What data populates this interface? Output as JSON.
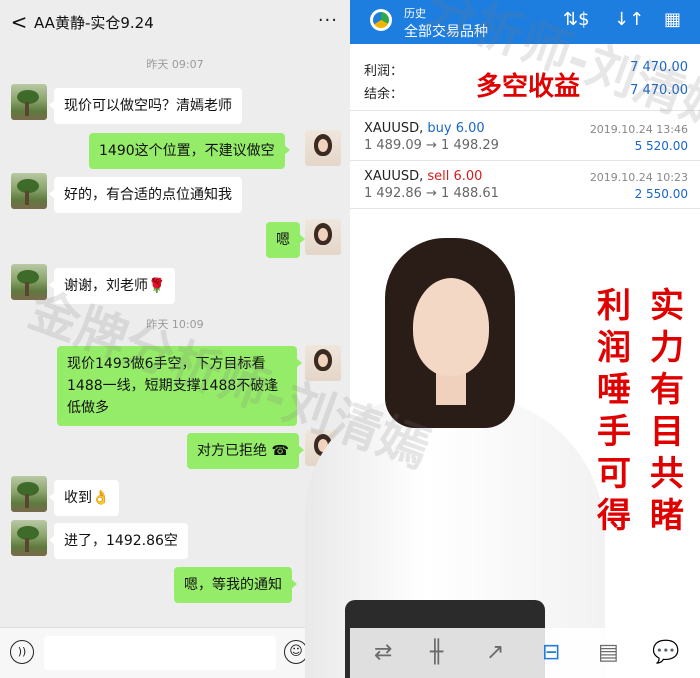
{
  "chat": {
    "title": "AA黄静-实仓9.24",
    "back_glyph": "<",
    "more_glyph": "···",
    "timestamps": [
      "昨天 09:07",
      "昨天 10:09"
    ],
    "messages": [
      {
        "side": "left",
        "text": "现价可以做空吗？清嫣老师"
      },
      {
        "side": "right",
        "text": "1490这个位置，不建议做空"
      },
      {
        "side": "left",
        "text": "好的，有合适的点位通知我"
      },
      {
        "side": "right",
        "text": "嗯"
      },
      {
        "side": "left",
        "text": "谢谢，刘老师🌹"
      },
      {
        "side": "right",
        "text": "现价1493做6手空，下方目标看1488一线，短期支撑1488不破逢低做多"
      },
      {
        "side": "right",
        "text": "对方已拒绝 ☎"
      },
      {
        "side": "left",
        "text": "收到👌"
      },
      {
        "side": "left",
        "text": "进了，1492.86空"
      },
      {
        "side": "right",
        "text": "嗯，等我的通知"
      }
    ],
    "input_placeholder": ""
  },
  "app": {
    "title": "历史",
    "subtitle": "全部交易品种",
    "header_icons": [
      "currency-icon",
      "sort-icon",
      "calendar-icon"
    ],
    "summary": {
      "profit_label": "利润：",
      "profit_value": "7 470.00",
      "balance_label": "结余：",
      "balance_value": "7 470.00"
    },
    "trades": [
      {
        "symbol": "XAUUSD,",
        "direction": "buy 6.00",
        "prices": "1 489.09 → 1 498.29",
        "time": "2019.10.24 13:46",
        "profit": "5 520.00"
      },
      {
        "symbol": "XAUUSD,",
        "direction": "sell 6.00",
        "prices": "1 492.86 → 1 488.61",
        "time": "2019.10.24 10:23",
        "profit": "2 550.00"
      }
    ],
    "promo_headline": "多空收益",
    "promo_col1": "实力有目共睹",
    "promo_col2": "利润唾手可得",
    "accent": "#1e7ee0",
    "red": "#e00000"
  },
  "watermark": {
    "left": "金牌分析师-刘清嫣",
    "right": "分析师-刘清嫣"
  },
  "nav": {
    "items": [
      "trade-icon",
      "chart-icon",
      "quotes-icon",
      "history-icon",
      "news-icon",
      "chat-icon"
    ],
    "active": "history-icon"
  }
}
